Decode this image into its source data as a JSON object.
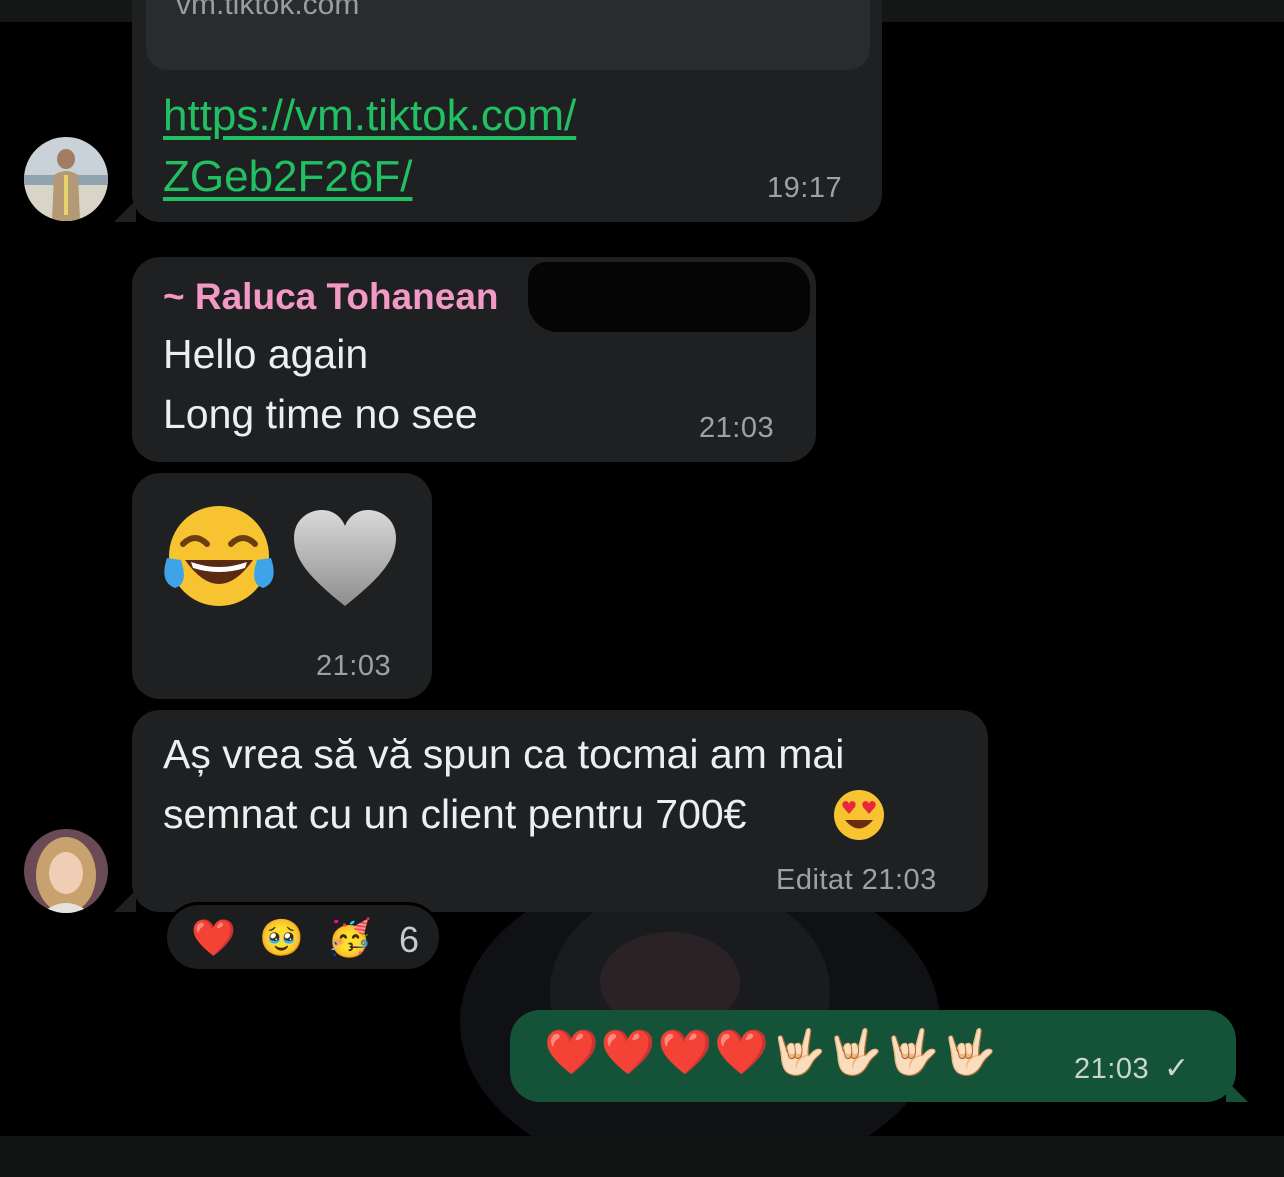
{
  "messages": {
    "link_preview": {
      "domain": "vm.tiktok.com",
      "url_line1": "https://vm.tiktok.com/",
      "url_line2": "ZGeb2F26F/",
      "time": "19:17",
      "avatar_icon": "profile-photo-man"
    },
    "text_message": {
      "sender": "~ Raluca Tohanean",
      "line1": "Hello again",
      "line2": "Long time no see",
      "time": "21:03"
    },
    "emoji_message": {
      "emojis": [
        "😂",
        "🩶"
      ],
      "time": "21:03"
    },
    "announcement": {
      "line1": "Aș vrea să vă spun ca tocmai am mai",
      "line2": "semnat cu un client pentru 700€",
      "emoji": "😍",
      "edited_label": "Editat 21:03",
      "avatar_icon": "profile-photo-woman",
      "reactions": [
        "❤️",
        "🥹",
        "🥳"
      ],
      "reaction_count": "6"
    },
    "outgoing": {
      "emojis": "❤️❤️❤️❤️🤟🏻🤟🏻🤟🏻🤟🏻",
      "time": "21:03",
      "status": "✓"
    }
  },
  "colors": {
    "background": "#000000",
    "incoming_bubble": "#1f2021",
    "outgoing_bubble": "#155339",
    "link": "#21c063",
    "sender_name": "#f29ac5"
  }
}
